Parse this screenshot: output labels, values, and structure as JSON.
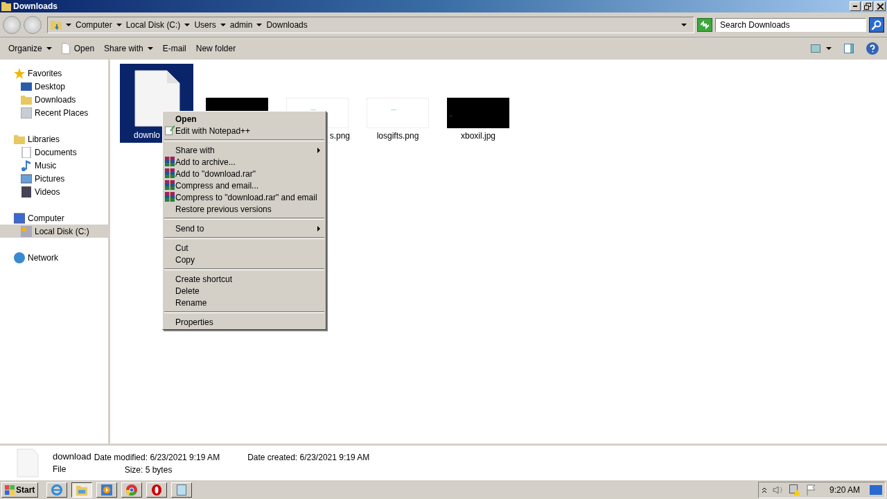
{
  "window": {
    "title": "Downloads"
  },
  "address_bar": {
    "crumbs": [
      "Computer",
      "Local Disk (C:)",
      "Users",
      "admin",
      "Downloads"
    ]
  },
  "search": {
    "placeholder": "Search Downloads"
  },
  "toolbar": [
    {
      "label": "Organize",
      "dropdown": true,
      "icon": false
    },
    {
      "label": "Open",
      "dropdown": false,
      "icon": true
    },
    {
      "label": "Share with",
      "dropdown": true,
      "icon": false
    },
    {
      "label": "E-mail",
      "dropdown": false,
      "icon": false
    },
    {
      "label": "New folder",
      "dropdown": false,
      "icon": false
    }
  ],
  "sidebar": {
    "groups": [
      {
        "label": "Favorites",
        "selected": false,
        "children": [
          {
            "label": "Desktop",
            "selected": false
          },
          {
            "label": "Downloads",
            "selected": false
          },
          {
            "label": "Recent Places",
            "selected": false
          }
        ]
      },
      {
        "label": "Libraries",
        "selected": false,
        "children": [
          {
            "label": "Documents",
            "selected": false
          },
          {
            "label": "Music",
            "selected": false
          },
          {
            "label": "Pictures",
            "selected": false
          },
          {
            "label": "Videos",
            "selected": false
          }
        ]
      },
      {
        "label": "Computer",
        "selected": false,
        "children": [
          {
            "label": "Local Disk (C:)",
            "selected": true
          }
        ]
      },
      {
        "label": "Network",
        "selected": false
      }
    ]
  },
  "files": [
    {
      "name": "downlo",
      "kind": "document",
      "selected": true
    },
    {
      "kind": "dark",
      "selected": false
    },
    {
      "name": "s.png",
      "kind": "light",
      "selected": false
    },
    {
      "name": "losgifts.png",
      "kind": "light",
      "selected": false
    },
    {
      "name": "xboxil.jpg",
      "kind": "dark",
      "selected": false
    }
  ],
  "context_menu": [
    {
      "kind": "plain",
      "label": "Open",
      "default": true
    },
    {
      "kind": "notepad",
      "label": "Edit with Notepad++",
      "default": false
    },
    {
      "kind": "separator"
    },
    {
      "kind": "submenu",
      "label": "Share with",
      "default": false
    },
    {
      "kind": "archive",
      "label": "Add to archive...",
      "default": false
    },
    {
      "kind": "archive",
      "label": "Add to \"download.rar\"",
      "default": false
    },
    {
      "kind": "archive",
      "label": "Compress and email...",
      "default": false
    },
    {
      "kind": "archive",
      "label": "Compress to \"download.rar\" and email",
      "default": false
    },
    {
      "kind": "plain",
      "label": "Restore previous versions",
      "default": false
    },
    {
      "kind": "separator"
    },
    {
      "kind": "submenu",
      "label": "Send to",
      "default": false
    },
    {
      "kind": "separator"
    },
    {
      "kind": "plain",
      "label": "Cut",
      "default": false
    },
    {
      "kind": "plain",
      "label": "Copy",
      "default": false
    },
    {
      "kind": "separator"
    },
    {
      "kind": "plain",
      "label": "Create shortcut",
      "default": false
    },
    {
      "kind": "plain",
      "label": "Delete",
      "default": false
    },
    {
      "kind": "plain",
      "label": "Rename",
      "default": false
    },
    {
      "kind": "separator"
    },
    {
      "kind": "plain",
      "label": "Properties",
      "default": false
    }
  ],
  "details": {
    "name": "download",
    "type": "File",
    "fields": [
      {
        "label": "Date modified:",
        "value": "6/23/2021 9:19 AM"
      },
      {
        "label": "Date created:",
        "value": "6/23/2021 9:19 AM"
      },
      {
        "label": "Size:",
        "value": "5 bytes"
      }
    ]
  },
  "taskbar": {
    "start": "Start",
    "apps": [
      {
        "selected": false
      },
      {
        "selected": true
      },
      {
        "selected": false
      },
      {
        "selected": false
      },
      {
        "selected": false
      },
      {
        "selected": false
      }
    ],
    "clock": "9:20 AM"
  }
}
